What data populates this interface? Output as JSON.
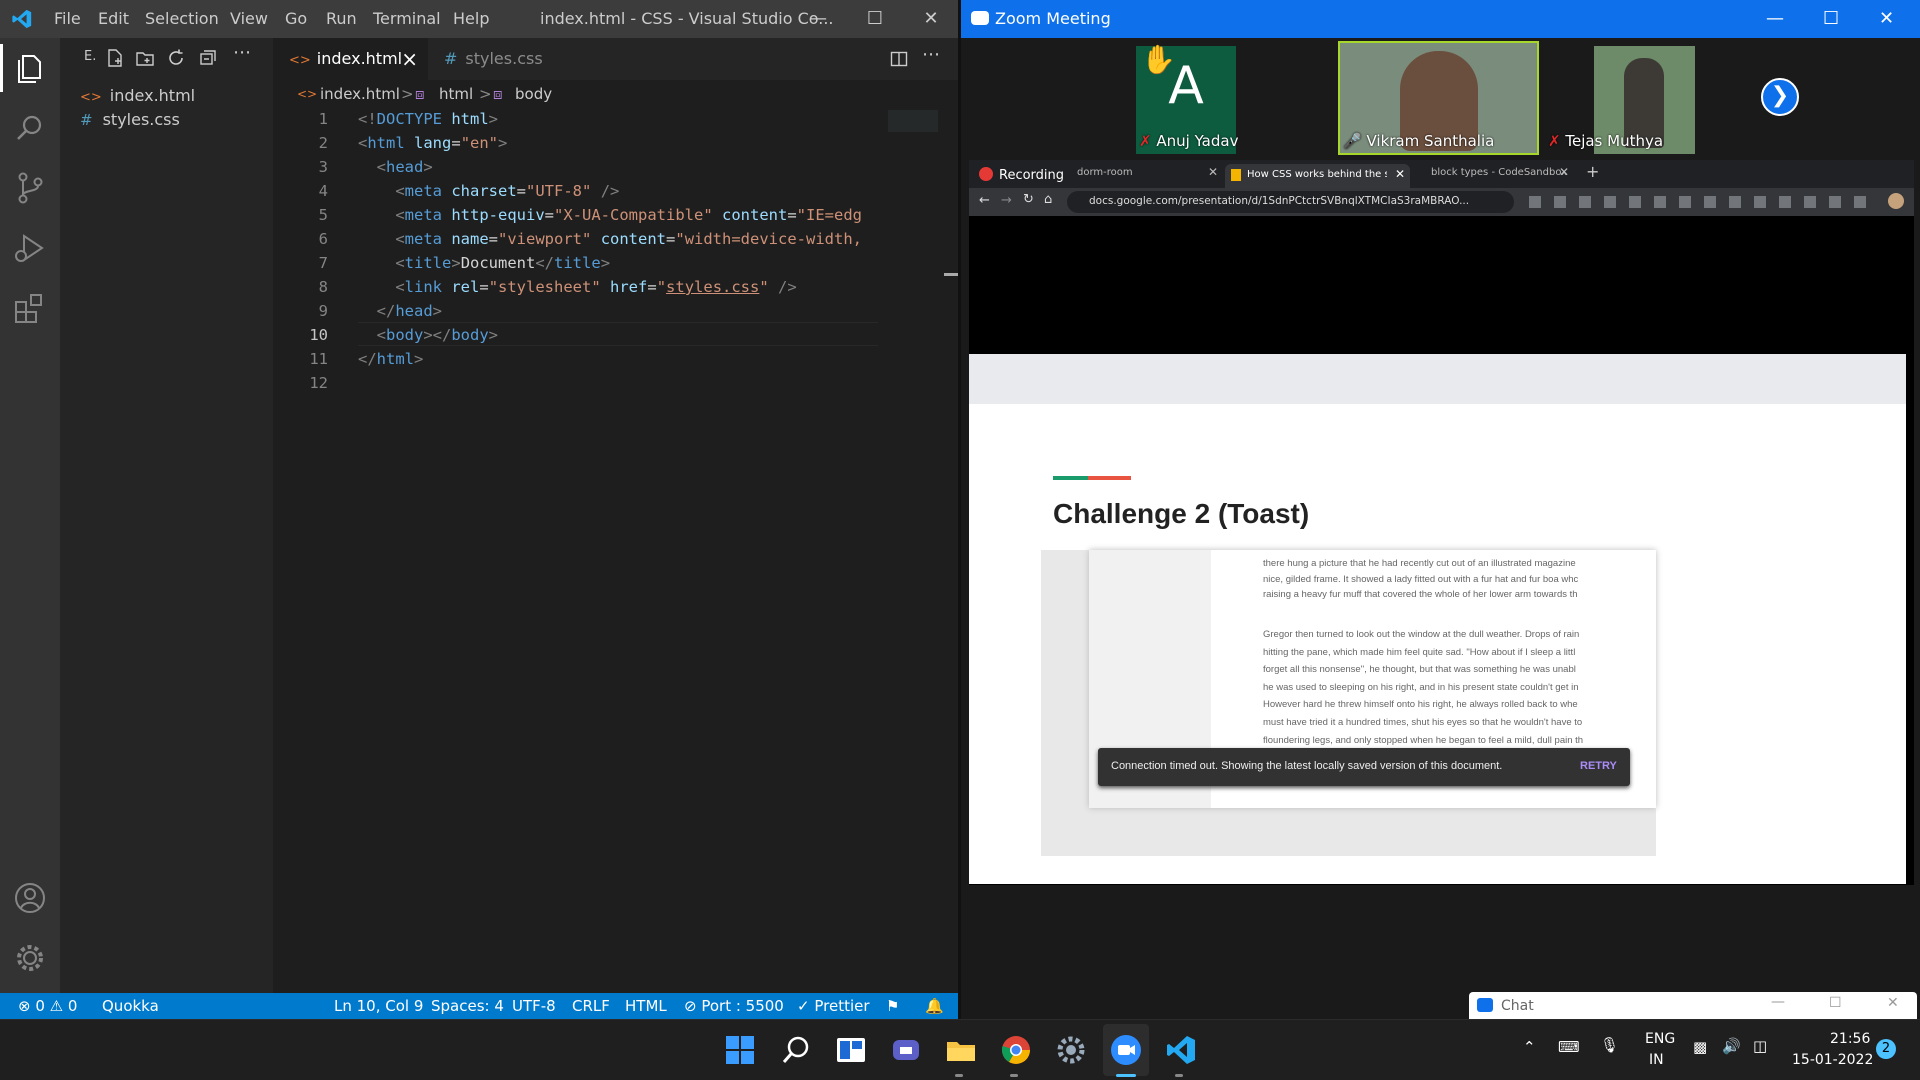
{
  "vscode": {
    "menu": [
      "File",
      "Edit",
      "Selection",
      "View",
      "Go",
      "Run",
      "Terminal",
      "Help"
    ],
    "window_title": "index.html - CSS - Visual Studio Co...",
    "explorer_label": "E.",
    "files": [
      {
        "name": "index.html",
        "icon": "<>"
      },
      {
        "name": "styles.css",
        "icon": "#"
      }
    ],
    "tabs": [
      {
        "name": "index.html",
        "icon": "<>",
        "active": true,
        "close": "×"
      },
      {
        "name": "styles.css",
        "icon": "#",
        "active": false
      }
    ],
    "breadcrumb": {
      "file": "index.html",
      "sep": ">",
      "html": "html",
      "body": "body"
    },
    "line_numbers": [
      "1",
      "2",
      "3",
      "4",
      "5",
      "6",
      "7",
      "8",
      "9",
      "10",
      "11",
      "12"
    ],
    "status": {
      "errors": "0",
      "warnings": "0",
      "quokka": "Quokka",
      "position": "Ln 10, Col 9",
      "spaces": "Spaces: 4",
      "encoding": "UTF-8",
      "eol": "CRLF",
      "language": "HTML",
      "port": "Port : 5500",
      "prettier": "Prettier"
    },
    "accent": "#007acc"
  },
  "zoom": {
    "title": "Zoom Meeting",
    "participants": [
      {
        "name": "Anuj Yadav",
        "initial": "A",
        "muted": true,
        "hand_raised": true
      },
      {
        "name": "Vikram Santhalia",
        "speaking": true
      },
      {
        "name": "Tejas Muthya",
        "muted": true
      }
    ],
    "recording": "Recording",
    "chrome": {
      "tabs": [
        "dorm-room",
        "How CSS works behind the sc",
        "block types - CodeSandbox"
      ],
      "url": "docs.google.com/presentation/d/1SdnPCtctrSVBnqlXTMCIaS3raMBRAO..."
    },
    "slide": {
      "title": "Challenge 2 (Toast)",
      "paragraph1": [
        "there hung a picture that he had recently cut out of an illustrated magazine",
        "nice, gilded frame. It showed a lady fitted out with a fur hat and fur boa whc",
        "raising a heavy fur muff that covered the whole of her lower arm towards th"
      ],
      "paragraph2": [
        "Gregor then turned to look out the window at the dull weather. Drops of rain",
        "hitting the pane, which made him feel quite sad. \"How about if I sleep a littl",
        "forget all this nonsense\", he thought, but that was something he was unabl",
        "he was used to sleeping on his right, and in his present state couldn't get in",
        "However hard he threw himself onto his right, he always rolled back to whe",
        "must have tried it a hundred times, shut his eyes so that he wouldn't have to",
        "floundering legs, and only stopped when he began to feel a mild, dull pain th"
      ],
      "toast": "Connection timed out. Showing the latest locally saved version of this document.",
      "toast_action": "RETRY"
    },
    "chat_title": "Chat",
    "accent": "#0e71eb"
  },
  "taskbar": {
    "lang": "ENG",
    "region": "IN",
    "time": "21:56",
    "date": "15-01-2022",
    "notifications": "2"
  }
}
